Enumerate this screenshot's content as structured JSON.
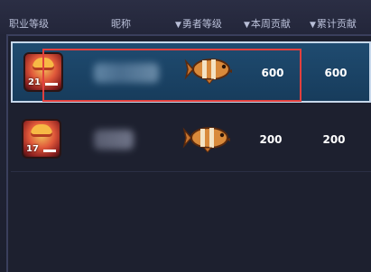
{
  "header": {
    "col_job": "职业等级",
    "col_name": "昵称",
    "col_brave": "勇者等级",
    "col_week": "本周贡献",
    "col_total": "累计贡献",
    "sort_arrow": "▼"
  },
  "rows": [
    {
      "job_level": "21",
      "brave_rank_icon": "fish-badge-icon",
      "week_contribution": "600",
      "total_contribution": "600",
      "selected": true
    },
    {
      "job_level": "17",
      "brave_rank_icon": "fish-badge-icon",
      "week_contribution": "200",
      "total_contribution": "200",
      "selected": false
    }
  ],
  "colors": {
    "selected_row": "#1f4b70",
    "highlight_outline": "#e2403e",
    "header_text": "#b9bfd8",
    "value_text": "#ffffff"
  }
}
